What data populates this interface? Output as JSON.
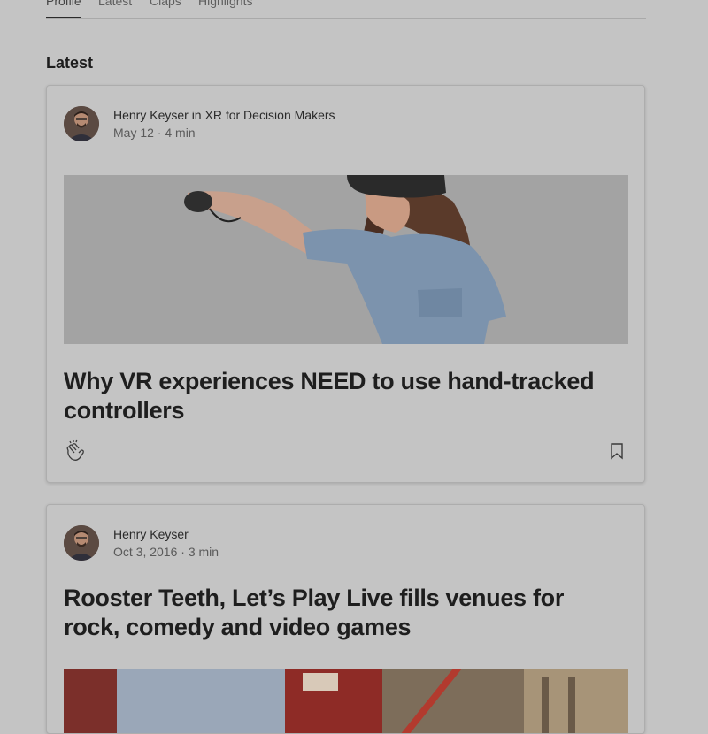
{
  "tabs": [
    {
      "label": "Profile",
      "active": true
    },
    {
      "label": "Latest",
      "active": false
    },
    {
      "label": "Claps",
      "active": false
    },
    {
      "label": "Highlights",
      "active": false
    }
  ],
  "section_title": "Latest",
  "posts": [
    {
      "author_line": "Henry Keyser in XR for Decision Makers",
      "meta": "May 12 · 4 min",
      "title": "Why VR experiences NEED to use hand-tracked controllers",
      "image": "vr-headset-woman-with-controller"
    },
    {
      "author_line": "Henry Keyser",
      "meta": "Oct 3, 2016 · 3 min",
      "title": "Rooster Teeth, Let’s Play Live fills venues for rock, comedy and video games",
      "image": "theater-marquee-street"
    }
  ],
  "icons": {
    "clap": "clap-icon",
    "bookmark": "bookmark-icon"
  },
  "colors": {
    "background": "#c4c4c4",
    "text": "#1e1e1e",
    "muted": "#5a5a5a"
  }
}
